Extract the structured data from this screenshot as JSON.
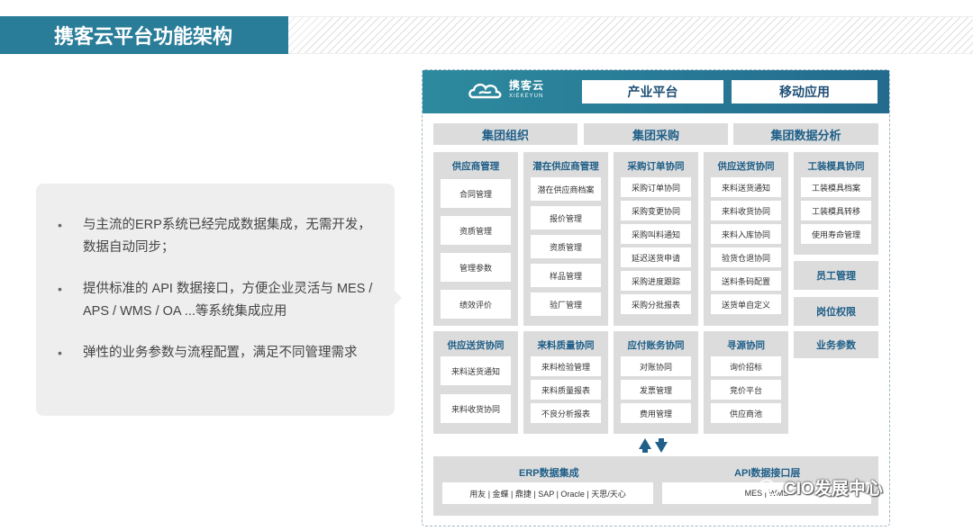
{
  "title": "携客云平台功能架构",
  "bullets": [
    "与主流的ERP系统已经完成数据集成，无需开发，数据自动同步；",
    "提供标准的 API 数据接口，方便企业灵活与 MES / APS / WMS / OA ...等系统集成应用",
    "弹性的业务参数与流程配置，满足不同管理需求"
  ],
  "bullet_marker": "•",
  "logo": {
    "name": "携客云",
    "sub": "XIEKEYUN"
  },
  "header": {
    "industry_platform": "产业平台",
    "mobile_app": "移动应用"
  },
  "group_bar": {
    "org": "集团组织",
    "purchase": "集团采购",
    "analytics": "集团数据分析"
  },
  "columns": {
    "supplier_mgmt": {
      "title": "供应商管理",
      "items": [
        "合同管理",
        "资质管理",
        "管理参数",
        "绩效评价"
      ]
    },
    "potential": {
      "title": "潜在供应商管理",
      "items": [
        "潜在供应商档案",
        "报价管理",
        "资质管理",
        "样品管理",
        "验厂管理"
      ]
    },
    "po_collab": {
      "title": "采购订单协同",
      "items": [
        "采购订单协同",
        "采购变更协同",
        "采购叫料通知",
        "延迟送货申请",
        "采购进度跟踪",
        "采购分批报表"
      ]
    },
    "delivery_collab": {
      "title": "供应送货协同",
      "items": [
        "来料送货通知",
        "来料收货协同",
        "来料入库协同",
        "验货仓退协同",
        "送料条码配置",
        "送货单自定义"
      ]
    },
    "tooling": {
      "title": "工装模具协同",
      "items": [
        "工装模具档案",
        "工装模具转移",
        "使用寿命管理"
      ]
    },
    "delivery2": {
      "title": "供应送货协同",
      "items": [
        "来料送货通知",
        "来料收货协同"
      ]
    },
    "quality": {
      "title": "来料质量协同",
      "items": [
        "来料检验管理",
        "来料质量报表",
        "不良分析报表"
      ]
    },
    "payable": {
      "title": "应付账务协同",
      "items": [
        "对账协同",
        "发票管理",
        "费用管理"
      ]
    },
    "sourcing": {
      "title": "寻源协同",
      "items": [
        "询价招标",
        "竞价平台",
        "供应商池"
      ]
    }
  },
  "side": {
    "staff": "员工管理",
    "roles": "岗位权限",
    "params": "业务参数"
  },
  "bottom": {
    "erp_title": "ERP数据集成",
    "erp_list": "用友 | 金蝶 | 鼎捷 | SAP | Oracle | 天思/天心",
    "api_title": "API数据接口层",
    "api_list": "MES | WMS"
  },
  "watermark": "CIO发展中心",
  "colors": {
    "banner": "#2a7d99",
    "header_gradient_start": "#2d8a9e",
    "header_gradient_end": "#236b8e",
    "module_title": "#1f5f88",
    "panel_grey": "#dcdcdc"
  }
}
